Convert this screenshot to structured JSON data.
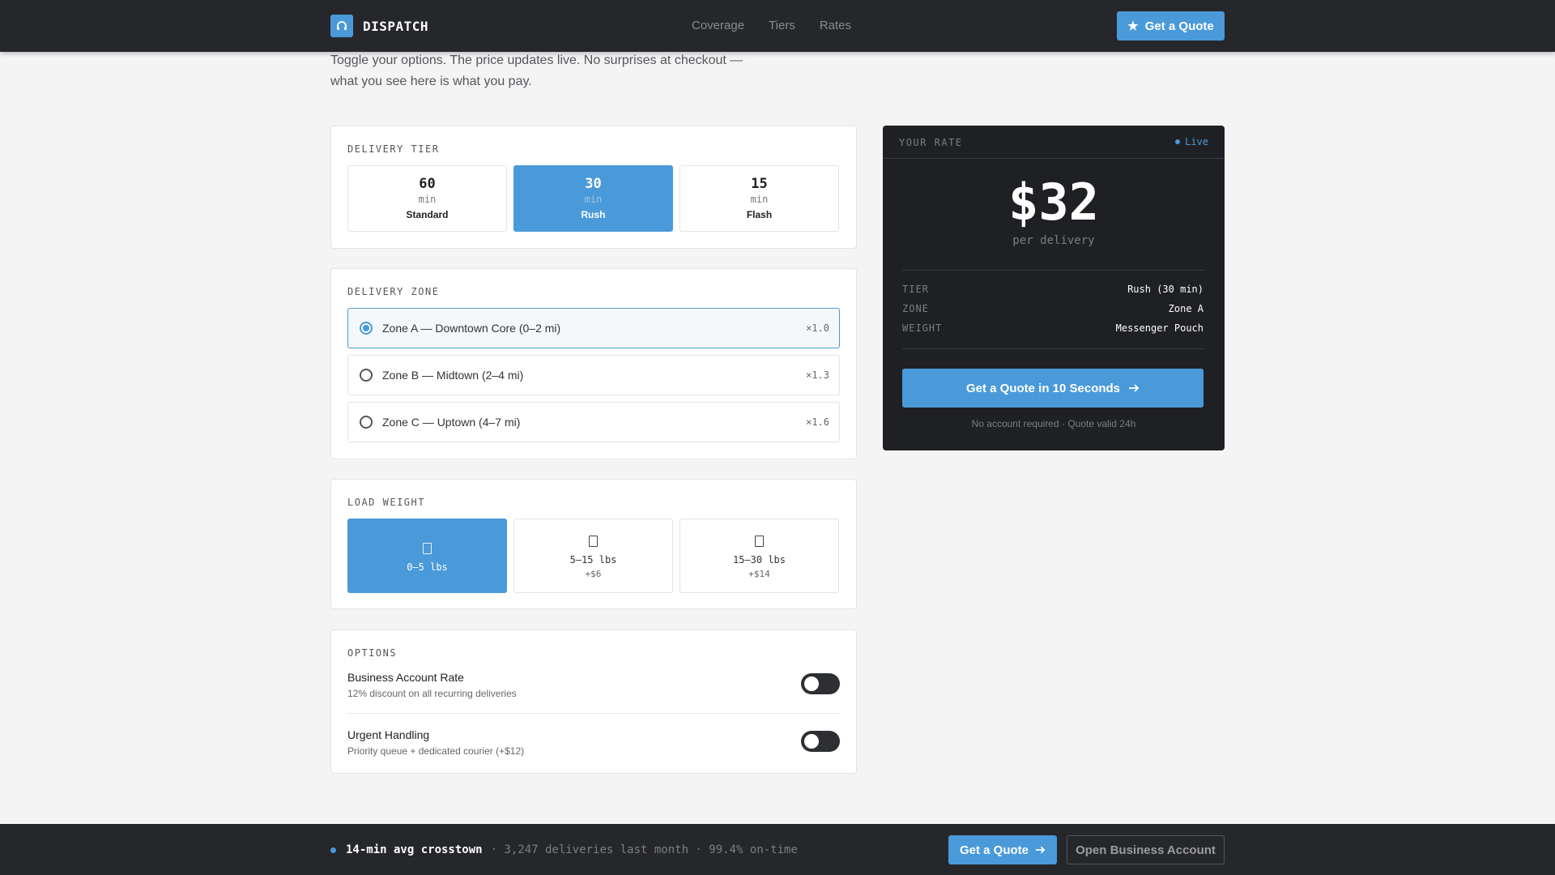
{
  "nav": {
    "brand": "DISPATCH",
    "brand_icon": "headset-icon",
    "links": [
      "Coverage",
      "Tiers",
      "Rates"
    ],
    "cta_icon": "★",
    "cta_label": "Get a Quote"
  },
  "intro": "Toggle your options. The price updates live. No surprises at checkout — what you see here is what you pay.",
  "tier": {
    "title": "DELIVERY TIER",
    "options": [
      {
        "num": "60",
        "unit": "min",
        "name": "Standard",
        "selected": false
      },
      {
        "num": "30",
        "unit": "min",
        "name": "Rush",
        "selected": true
      },
      {
        "num": "15",
        "unit": "min",
        "name": "Flash",
        "selected": false
      }
    ]
  },
  "zone": {
    "title": "DELIVERY ZONE",
    "options": [
      {
        "label": "Zone A — Downtown Core (0–2 mi)",
        "mult": "×1.0",
        "selected": true
      },
      {
        "label": "Zone B — Midtown (2–4 mi)",
        "mult": "×1.3",
        "selected": false
      },
      {
        "label": "Zone C — Uptown (4–7 mi)",
        "mult": "×1.6",
        "selected": false
      }
    ]
  },
  "weight": {
    "title": "LOAD WEIGHT",
    "options": [
      {
        "label": "0–5 lbs",
        "price": "",
        "icon": "box-icon",
        "selected": true
      },
      {
        "label": "5–15 lbs",
        "price": "+$6",
        "icon": "box-icon",
        "selected": false
      },
      {
        "label": "15–30 lbs",
        "price": "+$14",
        "icon": "box-icon",
        "selected": false
      }
    ]
  },
  "options": {
    "title": "OPTIONS",
    "items": [
      {
        "name": "Business Account Rate",
        "desc": "12% discount on all recurring deliveries",
        "enabled": false
      },
      {
        "name": "Urgent Handling",
        "desc": "Priority queue + dedicated courier (+$12)",
        "enabled": false
      }
    ]
  },
  "rate": {
    "title": "YOUR RATE",
    "live": "Live",
    "price": "$32",
    "per": "per delivery",
    "rows": [
      {
        "key": "TIER",
        "value": "Rush (30 min)"
      },
      {
        "key": "ZONE",
        "value": "Zone A"
      },
      {
        "key": "WEIGHT",
        "value": "Messenger Pouch"
      }
    ],
    "cta": "Get a Quote in 10 Seconds",
    "note": "No account required · Quote valid 24h"
  },
  "bottom": {
    "stat_main": "14-min avg crosstown",
    "stat_sub": "· 3,247 deliveries last month · 99.4% on-time",
    "quote": "Get a Quote",
    "account": "Open Business Account"
  },
  "colors": {
    "accent": "#4a9ad9",
    "dark": "#26272b",
    "panel": "#1f2023"
  }
}
